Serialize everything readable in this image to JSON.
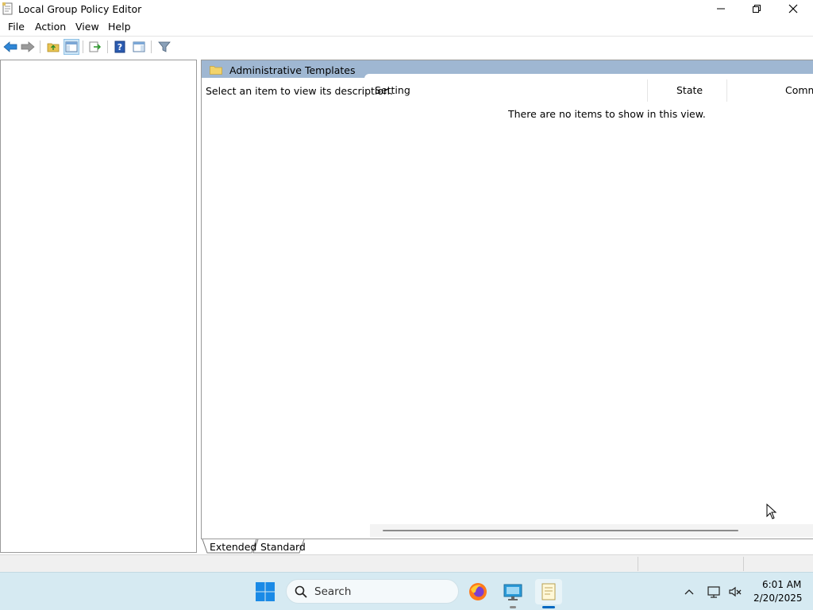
{
  "window": {
    "title": "Local Group Policy Editor"
  },
  "menu": {
    "file": "File",
    "action": "Action",
    "view": "View",
    "help": "Help"
  },
  "toolbar": {
    "icons": [
      "back-arrow-icon",
      "forward-arrow-icon",
      "up-folder-icon",
      "show-hide-tree-icon",
      "export-list-icon",
      "help-icon",
      "show-hide-action-pane-icon",
      "filter-icon"
    ]
  },
  "right_pane": {
    "header_title": "Administrative Templates",
    "description": "Select an item to view its description.",
    "columns": {
      "setting": "Setting",
      "state": "State",
      "comment": "Comment"
    },
    "empty_message": "There are no items to show in this view."
  },
  "tabs": {
    "extended": "Extended",
    "standard": "Standard"
  },
  "taskbar": {
    "search_placeholder": "Search",
    "time": "6:01 AM",
    "date": "2/20/2025"
  },
  "colors": {
    "pane_header": "#9fb7d2",
    "taskbar": "#d6eaf2",
    "accent": "#0067c0"
  }
}
